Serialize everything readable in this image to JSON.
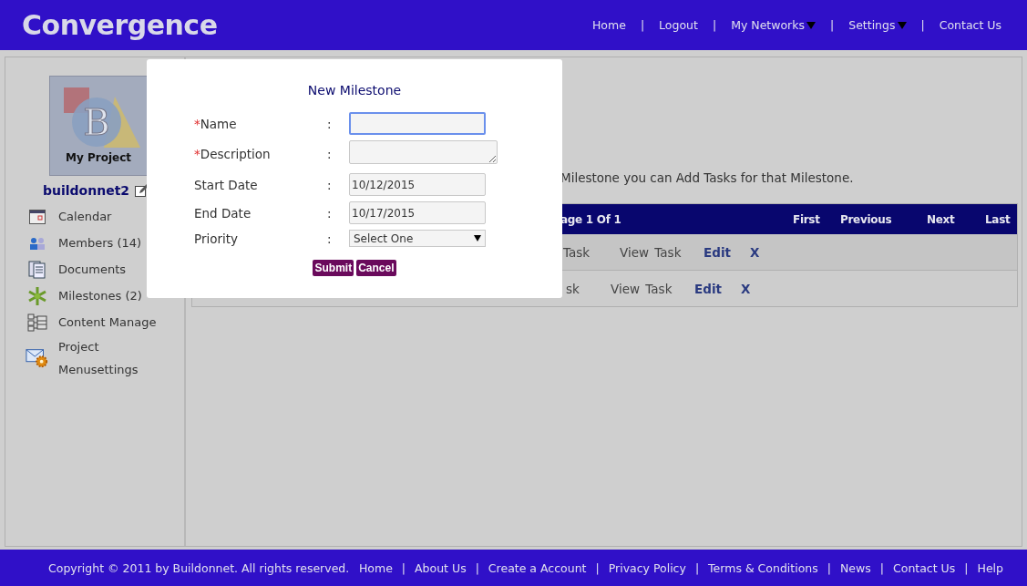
{
  "header": {
    "brand": "Convergence",
    "nav": [
      {
        "kind": "link",
        "label": "Home",
        "dropdown": false
      },
      {
        "kind": "sep",
        "label": "|"
      },
      {
        "kind": "link",
        "label": "Logout",
        "dropdown": false
      },
      {
        "kind": "sep",
        "label": "|"
      },
      {
        "kind": "link",
        "label": "My Networks",
        "dropdown": true
      },
      {
        "kind": "sep",
        "label": "|"
      },
      {
        "kind": "link",
        "label": "Settings",
        "dropdown": true
      },
      {
        "kind": "sep",
        "label": "|"
      },
      {
        "kind": "link",
        "label": "Contact Us",
        "dropdown": false
      }
    ]
  },
  "sidebar": {
    "logo_letter": "B",
    "logo_caption": "My Project",
    "project_name": "buildonnet2",
    "items": [
      {
        "label": "Calendar"
      },
      {
        "label": "Members (14)"
      },
      {
        "label": "Documents"
      },
      {
        "label": "Milestones (2)"
      },
      {
        "label": "Content Manage"
      },
      {
        "label": "Project Menusettings"
      }
    ]
  },
  "content": {
    "intro": "Milestone you can Add Tasks for that Milestone.",
    "table": {
      "page_label": "age 1 Of 1",
      "pager": [
        "First",
        "Previous",
        "Next",
        "Last"
      ],
      "rows": [
        {
          "task": "Task",
          "view": "View Task",
          "edit": "Edit",
          "delete": "X"
        },
        {
          "task": "sk",
          "view": "View Task",
          "edit": "Edit",
          "delete": "X"
        }
      ]
    }
  },
  "dialog": {
    "title": "New Milestone",
    "fields": [
      {
        "kind": "text",
        "label": "Name",
        "required": true,
        "focused": true
      },
      {
        "kind": "textarea",
        "label": "Description",
        "required": true,
        "focused": false
      },
      {
        "kind": "text",
        "label": "Start Date",
        "required": false,
        "value": "10/12/2015",
        "focused": false
      },
      {
        "kind": "text",
        "label": "End Date",
        "required": false,
        "value": "10/17/2015",
        "focused": false
      },
      {
        "kind": "select",
        "label": "Priority",
        "required": false,
        "value": "Select One",
        "focused": false
      }
    ],
    "separator": ":",
    "required_mark": "*",
    "buttons": [
      "Submit",
      "Cancel"
    ]
  },
  "footer": {
    "copyright": "Copyright © 2011 by Buildonnet. All rights reserved.",
    "links": [
      {
        "kind": "link",
        "label": "Home"
      },
      {
        "kind": "sep",
        "label": "|"
      },
      {
        "kind": "link",
        "label": "About Us"
      },
      {
        "kind": "sep",
        "label": "|"
      },
      {
        "kind": "link",
        "label": "Create a Account"
      },
      {
        "kind": "sep",
        "label": "|"
      },
      {
        "kind": "link",
        "label": "Privacy Policy"
      },
      {
        "kind": "sep",
        "label": "|"
      },
      {
        "kind": "link",
        "label": "Terms & Conditions"
      },
      {
        "kind": "sep",
        "label": "|"
      },
      {
        "kind": "link",
        "label": "News"
      },
      {
        "kind": "sep",
        "label": "|"
      },
      {
        "kind": "link",
        "label": "Contact Us"
      },
      {
        "kind": "sep",
        "label": "|"
      },
      {
        "kind": "link",
        "label": "Help"
      }
    ]
  }
}
